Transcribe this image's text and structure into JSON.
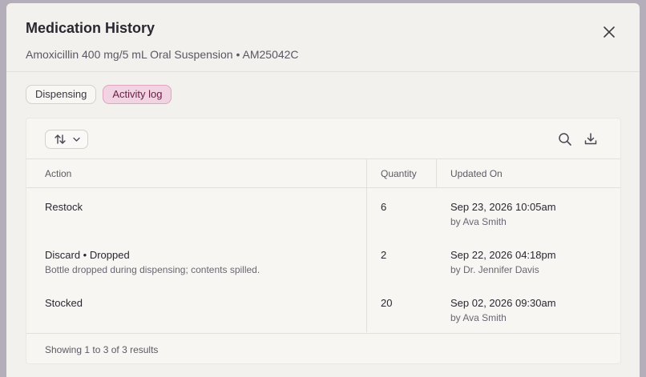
{
  "modal": {
    "title": "Medication History",
    "subtitle": "Amoxicillin 400 mg/5 mL Oral Suspension • AM25042C"
  },
  "tabs": [
    {
      "label": "Dispensing",
      "active": false
    },
    {
      "label": "Activity log",
      "active": true
    }
  ],
  "toolbar": {
    "sort_icon": "sort-arrows-icon",
    "search_icon": "search-icon",
    "download_icon": "download-icon"
  },
  "table": {
    "headers": {
      "action": "Action",
      "quantity": "Quantity",
      "updated_on": "Updated On"
    },
    "rows": [
      {
        "action": "Restock",
        "note": "",
        "quantity": "6",
        "date": "Sep 23, 2026 10:05am",
        "by": "by Ava Smith"
      },
      {
        "action": "Discard • Dropped",
        "note": "Bottle dropped during dispensing; contents spilled.",
        "quantity": "2",
        "date": "Sep 22, 2026 04:18pm",
        "by": "by Dr. Jennifer Davis"
      },
      {
        "action": "Stocked",
        "note": "",
        "quantity": "20",
        "date": "Sep 02, 2026 09:30am",
        "by": "by Ava Smith"
      }
    ]
  },
  "footer": {
    "summary": "Showing 1 to 3 of 3 results"
  },
  "colors": {
    "accent": "#f1d3e1",
    "accent_text": "#6a1e46",
    "overlay": "#b3aeb9"
  }
}
